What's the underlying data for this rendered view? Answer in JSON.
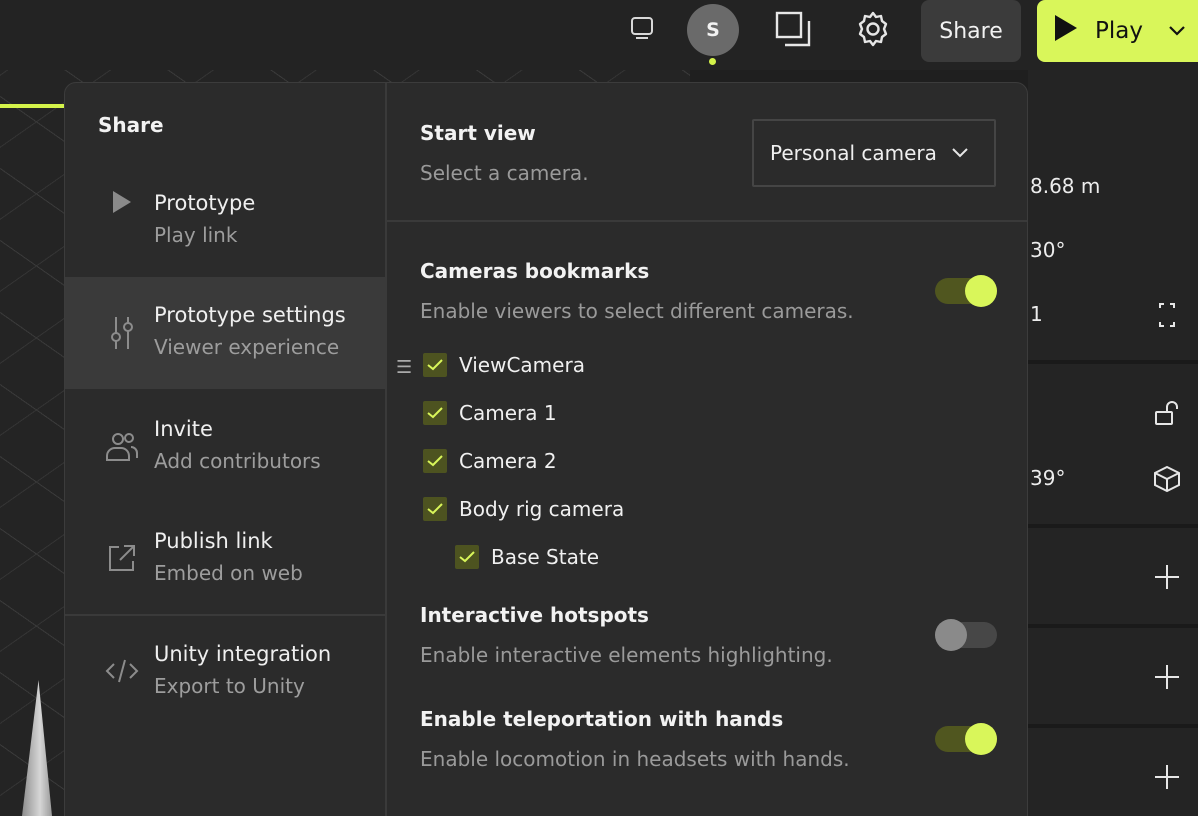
{
  "topbar": {
    "avatar_initial": "S",
    "share_label": "Share",
    "play_label": "Play",
    "accent_color": "#d9f65a"
  },
  "right_panel": {
    "values": [
      "8.68 m",
      "30°",
      "1",
      "39°"
    ],
    "icons": [
      "expand-icon",
      "unlock-icon",
      "cube-icon",
      "plus-icon",
      "plus-icon",
      "plus-icon"
    ]
  },
  "share_panel": {
    "title": "Share",
    "nav": [
      {
        "label": "Prototype",
        "sub": "Play link",
        "icon": "play-triangle-icon",
        "active": false
      },
      {
        "label": "Prototype settings",
        "sub": "Viewer experience",
        "icon": "sliders-icon",
        "active": true
      },
      {
        "label": "Invite",
        "sub": "Add contributors",
        "icon": "people-icon",
        "active": false
      },
      {
        "label": "Publish link",
        "sub": "Embed on web",
        "icon": "external-link-icon",
        "active": false
      },
      {
        "label": "Unity integration",
        "sub": "Export to Unity",
        "icon": "code-icon",
        "active": false
      }
    ]
  },
  "settings": {
    "start_view": {
      "title": "Start view",
      "desc": "Select a camera.",
      "selected": "Personal camera"
    },
    "camera_bookmarks": {
      "title": "Cameras bookmarks",
      "desc": "Enable viewers to select different cameras.",
      "enabled": true,
      "cameras": [
        {
          "label": "ViewCamera",
          "checked": true
        },
        {
          "label": "Camera 1",
          "checked": true
        },
        {
          "label": "Camera 2",
          "checked": true
        },
        {
          "label": "Body rig camera",
          "checked": true
        },
        {
          "label": "Base State",
          "checked": true
        }
      ]
    },
    "hotspots": {
      "title": "Interactive hotspots",
      "desc": "Enable interactive elements highlighting.",
      "enabled": false
    },
    "teleport": {
      "title": "Enable teleportation with hands",
      "desc": "Enable locomotion in headsets with hands.",
      "enabled": true
    }
  }
}
